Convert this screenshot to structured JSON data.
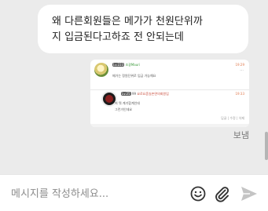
{
  "message": {
    "line1": "왜 다른회원들은 메가가 천원단위까",
    "line2": "지 입금된다고하죠 전 안되는데"
  },
  "attachment": {
    "post1": {
      "level": "Lv.223",
      "nickname": "조광Mauri",
      "time": "19:29",
      "dots": "···",
      "text": "메가는 정원단위로 입금 가능해요"
    },
    "post2": {
      "level": "Lv.25",
      "badge": "99",
      "nickname": "요로요혼실손면의회원입",
      "time": "19:33",
      "text1": "저 뭐 계기합계인데",
      "text2": "그런거인데요",
      "actions": "답글 | 수정 | 삭제"
    }
  },
  "status": "보냄",
  "composer": {
    "placeholder": "메시지를 작성하세요..."
  }
}
